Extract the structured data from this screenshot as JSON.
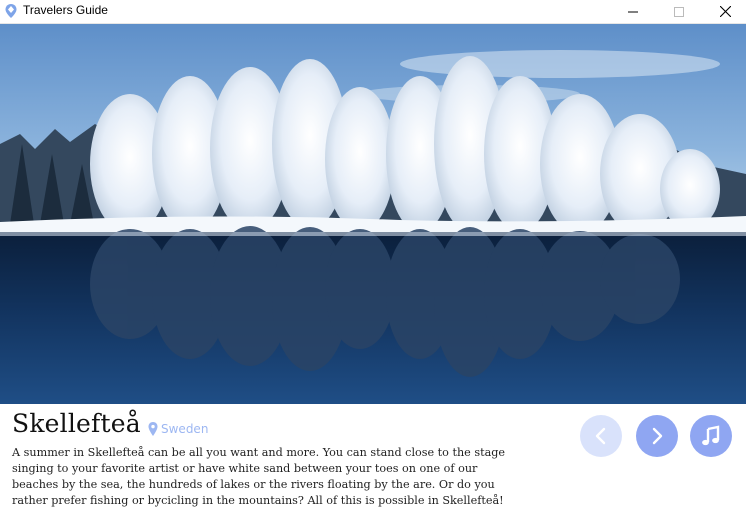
{
  "window": {
    "title": "Travelers Guide"
  },
  "place": {
    "name": "Skellefteå",
    "country": "Sweden",
    "description": "A summer in Skellefteå can be all you want and more. You can stand close to the stage singing to your favorite artist or have white sand between your toes on one of our beaches by the sea, the hundreds of lakes or the rivers floating by the are.  Or do you rather prefer fishing or bycicling in the mountains? All of this is possible in Skellefteå!"
  },
  "icons": {
    "app": "map-pin-icon",
    "location": "location-pin-icon",
    "prev": "chevron-left-icon",
    "next": "chevron-right-icon",
    "music": "music-note-icon"
  },
  "colors": {
    "accent": "#8fa6f2",
    "accent_disabled": "#d9e2fb",
    "location_text": "#9db7f2"
  }
}
